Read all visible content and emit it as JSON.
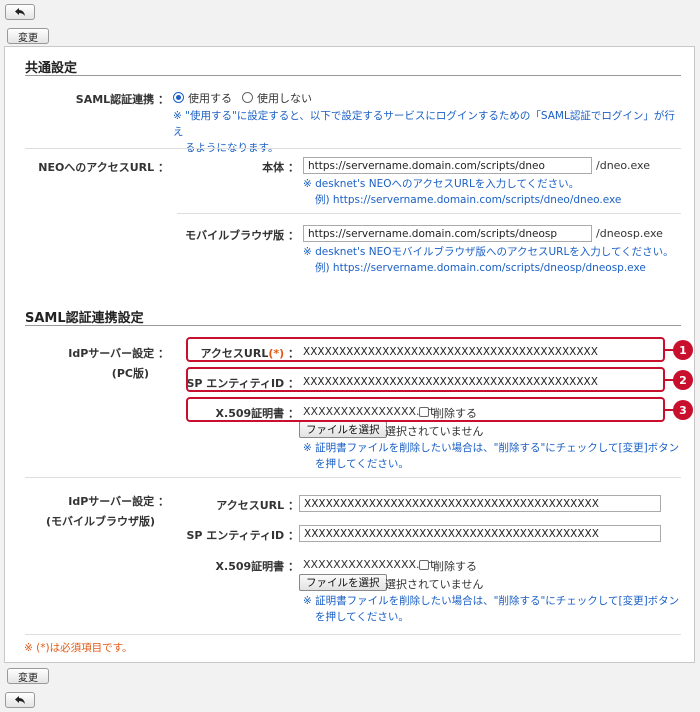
{
  "toolbar": {
    "back_icon": "undo-arrow-icon",
    "change_label": "変更"
  },
  "common": {
    "title": "共通設定",
    "saml_label": "SAML認証連携 ：",
    "radio_use": "使用する",
    "radio_not_use": "使用しない",
    "saml_selected": "使用する",
    "saml_note_1": "※ \"使用する\"に設定すると、以下で設定するサービスにログインするための「SAML認証でログイン」が行え",
    "saml_note_2": "るようになります。",
    "neo_url_label": "NEOへのアクセスURL ：",
    "main_label": "本体 ：",
    "main_value": "https://servername.domain.com/scripts/dneo",
    "main_suffix": "/dneo.exe",
    "main_note": "※ desknet's NEOへのアクセスURLを入力してください。",
    "main_example": "例) https://servername.domain.com/scripts/dneo/dneo.exe",
    "mobile_label": "モバイルブラウザ版 ：",
    "mobile_value": "https://servername.domain.com/scripts/dneosp",
    "mobile_suffix": "/dneosp.exe",
    "mobile_note": "※ desknet's NEOモバイルブラウザ版へのアクセスURLを入力してください。",
    "mobile_example": "例) https://servername.domain.com/scripts/dneosp/dneosp.exe"
  },
  "saml": {
    "title": "SAML認証連携設定",
    "pc_group_line1": "IdPサーバー設定 ：",
    "pc_group_line2": "(PC版)",
    "mobile_group_line1": "IdPサーバー設定 ：",
    "mobile_group_line2": "(モバイルブラウザ版)",
    "access_url_label": "アクセスURL",
    "required_mark": "(*)",
    "colon": "：",
    "sp_entity_label": "SP エンティティID ：",
    "access_url_label_plain": "アクセスURL ：",
    "x509_label": "X.509証明書 ：",
    "pc_access_url": "XXXXXXXXXXXXXXXXXXXXXXXXXXXXXXXXXXXXXXXXX",
    "pc_sp_entity": "XXXXXXXXXXXXXXXXXXXXXXXXXXXXXXXXXXXXXXXXX",
    "pc_cert_file": "XXXXXXXXXXXXXXX.crt",
    "mobile_access_url": "XXXXXXXXXXXXXXXXXXXXXXXXXXXXXXXXXXXXXXXXX",
    "mobile_sp_entity": "XXXXXXXXXXXXXXXXXXXXXXXXXXXXXXXXXXXXXXXXX",
    "mobile_cert_file": "XXXXXXXXXXXXXXX.crt",
    "delete_label": "削除する",
    "file_button": "ファイルを選択",
    "no_file": "選択されていません",
    "cert_note_1": "※ 証明書ファイルを削除したい場合は、\"削除する\"にチェックして[変更]ボタン",
    "cert_note_2": "を押してください。"
  },
  "callouts": [
    "1",
    "2",
    "3"
  ],
  "required_footer": "※ (*)は必須項目です。",
  "colors": {
    "accent_blue": "#1a5fc5",
    "callout_red": "#c8102e",
    "required_orange": "#e05a14"
  }
}
